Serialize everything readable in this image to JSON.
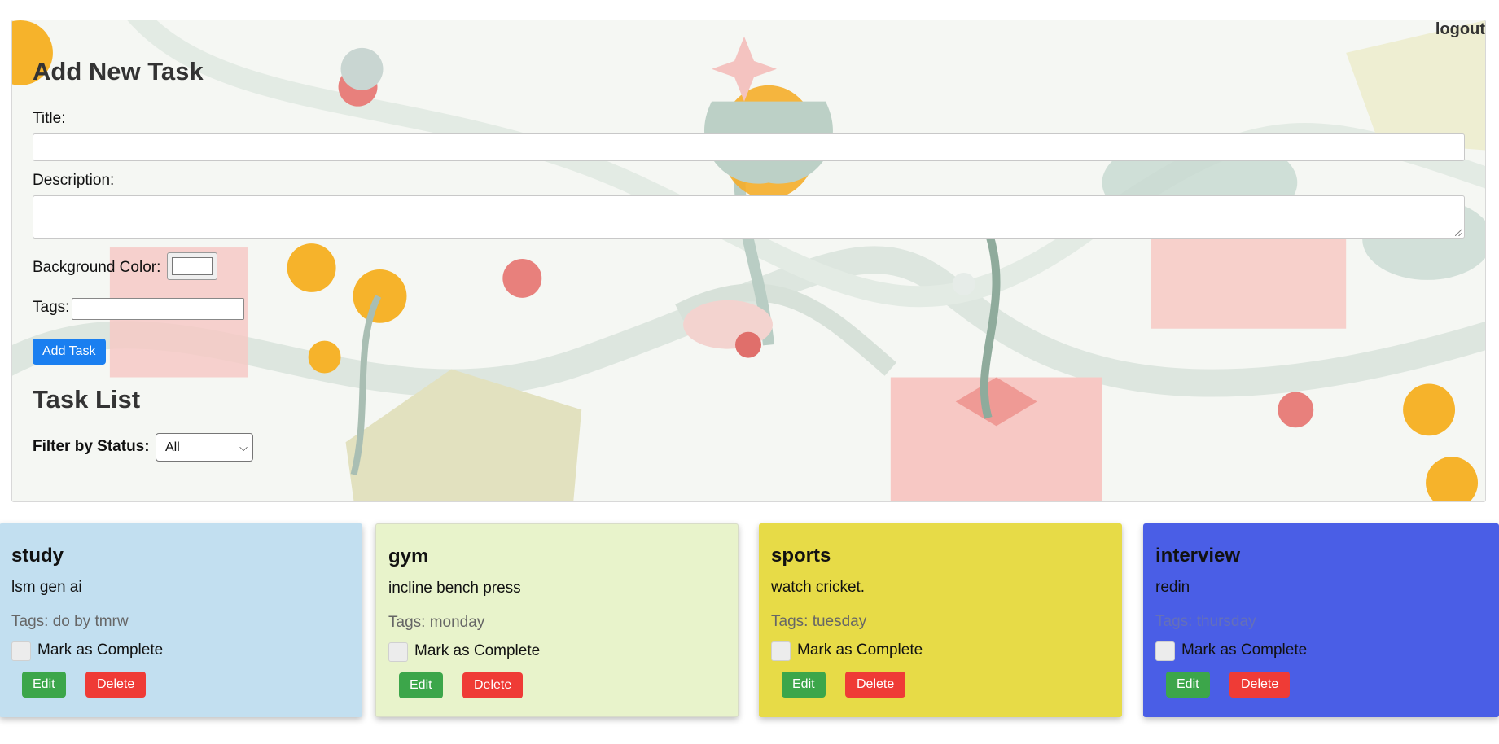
{
  "header": {
    "logout_label": "logout"
  },
  "form": {
    "heading": "Add New Task",
    "title_label": "Title:",
    "title_value": "",
    "description_label": "Description:",
    "description_value": "",
    "bg_color_label": "Background Color:",
    "bg_color_value": "#ffffff",
    "tags_label": "Tags:",
    "tags_value": "",
    "submit_label": "Add Task"
  },
  "task_list": {
    "heading": "Task List",
    "filter_label": "Filter by Status:",
    "filter_value": "All"
  },
  "tasks": [
    {
      "title": "study",
      "description": "lsm gen ai",
      "tags": "Tags: do by tmrw",
      "complete_label": "Mark as Complete",
      "edit_label": "Edit",
      "delete_label": "Delete",
      "bg_color": "#c2dff0"
    },
    {
      "title": "gym",
      "description": "incline bench press",
      "tags": "Tags: monday",
      "complete_label": "Mark as Complete",
      "edit_label": "Edit",
      "delete_label": "Delete",
      "bg_color": "#e8f3cb"
    },
    {
      "title": "sports",
      "description": "watch cricket.",
      "tags": "Tags: tuesday",
      "complete_label": "Mark as Complete",
      "edit_label": "Edit",
      "delete_label": "Delete",
      "bg_color": "#e7db47"
    },
    {
      "title": "interview",
      "description": "redin",
      "tags": "Tags: thursday",
      "complete_label": "Mark as Complete",
      "edit_label": "Edit",
      "delete_label": "Delete",
      "bg_color": "#4a5ee6"
    }
  ],
  "colors": {
    "primary_button": "#1a7ff0",
    "edit_button": "#3ca64a",
    "delete_button": "#ef3b36"
  },
  "icons": {
    "select_arrow": "chevron-down-icon",
    "textarea_resize": "resize-grip-icon"
  }
}
